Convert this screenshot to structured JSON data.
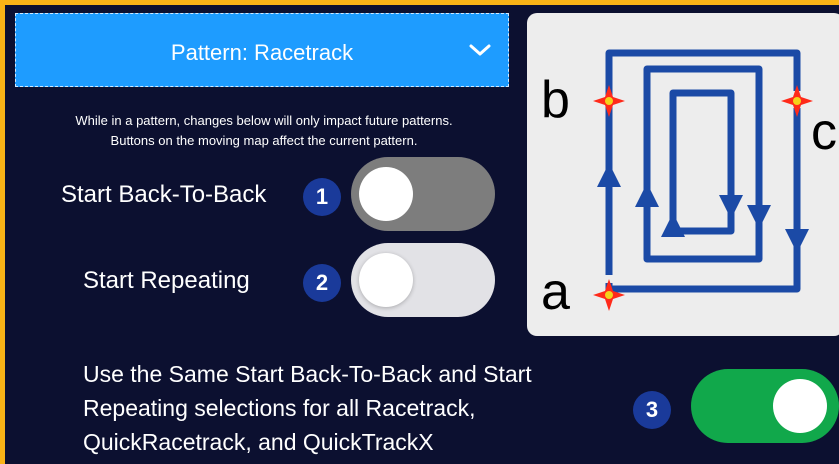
{
  "dropdown": {
    "label": "Pattern: Racetrack"
  },
  "note": {
    "line1": "While in a pattern, changes below will only impact future patterns.",
    "line2": "Buttons on the moving map affect the current pattern."
  },
  "settings": [
    {
      "label": "Start Back-To-Back",
      "badge": "1",
      "state": "off"
    },
    {
      "label": "Start Repeating",
      "badge": "2",
      "state": "off"
    }
  ],
  "same_selection": {
    "line1": "Use the Same Start Back-To-Back and Start",
    "line2": "Repeating selections for all Racetrack,",
    "line3": "QuickRacetrack, and QuickTrackX",
    "badge": "3",
    "state": "on"
  },
  "diagram": {
    "label_a": "a",
    "label_b": "b",
    "label_c": "c"
  },
  "colors": {
    "panel": "#0c1030",
    "border": "#f9b316",
    "dropdown": "#1e9cff",
    "badge": "#1a3a9a",
    "toggle_on": "#11a84b",
    "track": "#1b4aa6",
    "marker": "#ff2a1a"
  }
}
